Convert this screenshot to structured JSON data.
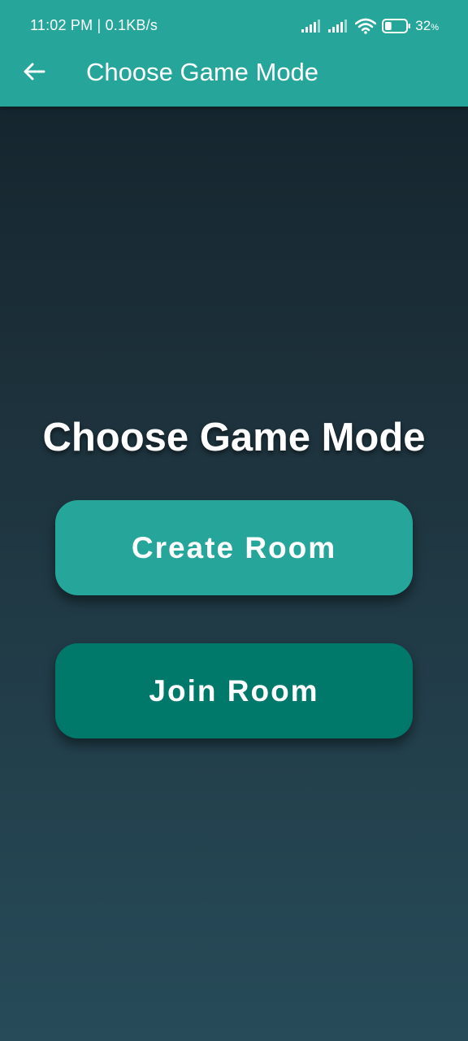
{
  "status_bar": {
    "time_speed": "11:02 PM | 0.1KB/s",
    "battery_percent": "32",
    "battery_percent_sign": "%",
    "battery_level": 0.32
  },
  "toolbar": {
    "back_icon": "arrow-left-icon",
    "title": "Choose Game Mode"
  },
  "main": {
    "heading": "Choose Game Mode",
    "create_room_label": "Create Room",
    "join_room_label": "Join Room"
  },
  "colors": {
    "primary": "#26a69a",
    "primary_dark": "#00796b",
    "background_top": "#13212a",
    "background_bottom": "#274b59"
  }
}
